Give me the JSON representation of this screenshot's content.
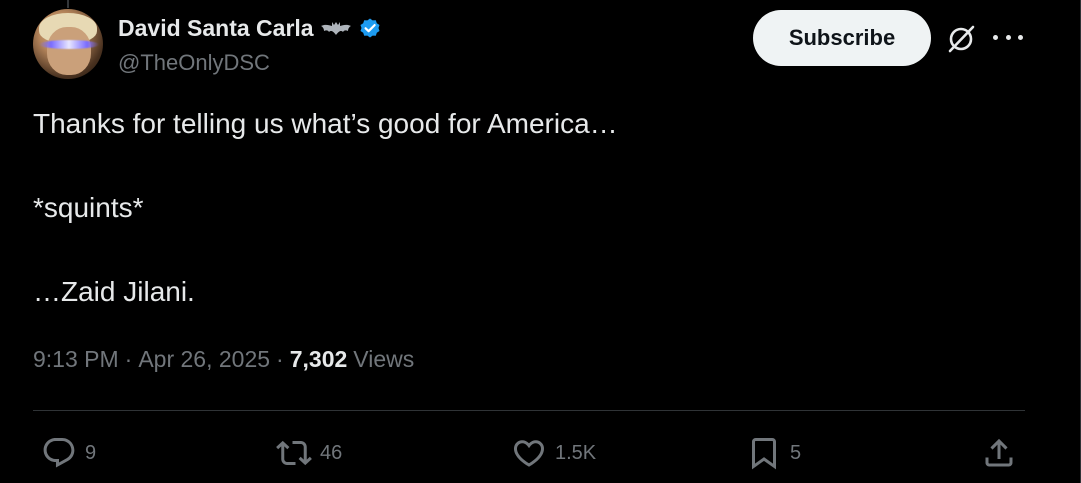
{
  "author": {
    "display_name": "David Santa Carla",
    "handle": "@TheOnlyDSC",
    "emoji_icon": "bat-emoji-icon",
    "verified": true,
    "verified_color": "#1d9bf0"
  },
  "header": {
    "subscribe_label": "Subscribe",
    "grok_icon": "grok-icon",
    "more_icon": "more-options-icon"
  },
  "tweet": {
    "lines": [
      "Thanks for telling us what’s good for America…",
      "*squints*",
      "…Zaid Jilani."
    ]
  },
  "meta": {
    "time": "9:13 PM",
    "separator": "·",
    "date": "Apr 26, 2025",
    "views_count": "7,302",
    "views_label": "Views"
  },
  "actions": {
    "replies": "9",
    "reposts": "46",
    "likes": "1.5K",
    "bookmarks": "5"
  },
  "colors": {
    "background": "#000000",
    "text_primary": "#e7e9ea",
    "text_secondary": "#71767b",
    "divider": "#2f3336",
    "button_bg": "#eff3f4"
  }
}
